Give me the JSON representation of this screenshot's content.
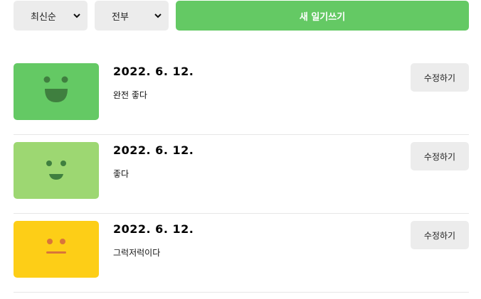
{
  "toolbar": {
    "sort_select": {
      "value": "최신순"
    },
    "filter_select": {
      "value": "전부"
    },
    "new_diary_button": "새 일기쓰기"
  },
  "diary_list": [
    {
      "date": "2022. 6. 12.",
      "content": "완전 좋다",
      "edit_label": "수정하기",
      "emotion_icon": "big-smile-icon",
      "color": "#64c964"
    },
    {
      "date": "2022. 6. 12.",
      "content": "좋다",
      "edit_label": "수정하기",
      "emotion_icon": "smile-icon",
      "color": "#9dd772"
    },
    {
      "date": "2022. 6. 12.",
      "content": "그럭저럭이다",
      "edit_label": "수정하기",
      "emotion_icon": "neutral-face-icon",
      "color": "#fdce17"
    }
  ]
}
